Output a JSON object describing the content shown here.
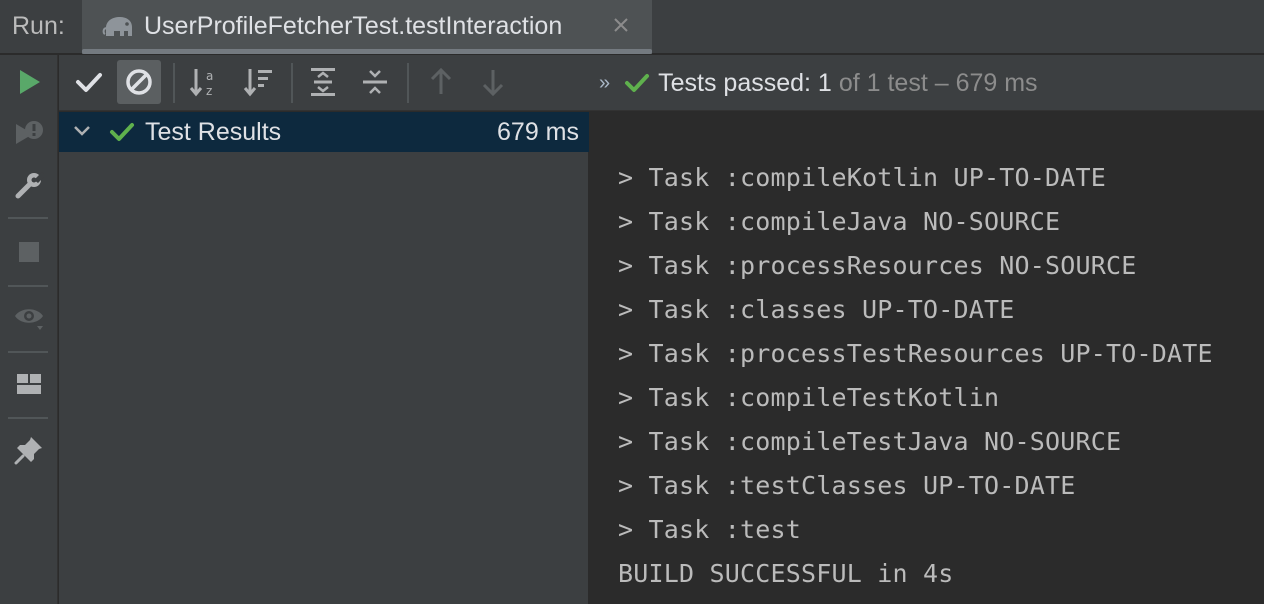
{
  "topbar": {
    "run_label": "Run:",
    "tab_title": "UserProfileFetcherTest.testInteraction",
    "tab_icon": "gradle-elephant-icon"
  },
  "left_toolbar": {
    "items": [
      "rerun-icon",
      "rerun-failed-icon",
      "settings-wrench-icon",
      "stop-icon",
      "show-preview-eye-icon",
      "layout-icon",
      "pin-icon"
    ]
  },
  "toolbar": {
    "items": [
      "show-passed-icon",
      "show-ignored-icon",
      "sort-alphabetically-icon",
      "sort-by-duration-icon",
      "expand-all-icon",
      "collapse-all-icon",
      "previous-failed-icon",
      "next-failed-icon"
    ],
    "more": "»"
  },
  "status": {
    "passed_text": "Tests passed: 1",
    "rest_text": "of 1 test – 679 ms",
    "color_success": "#5fb14d"
  },
  "tree": {
    "root_label": "Test Results",
    "root_time": "679 ms"
  },
  "console": {
    "lines": [
      "> Task :compileKotlin UP-TO-DATE",
      "> Task :compileJava NO-SOURCE",
      "> Task :processResources NO-SOURCE",
      "> Task :classes UP-TO-DATE",
      "> Task :processTestResources UP-TO-DATE",
      "> Task :compileTestKotlin",
      "> Task :compileTestJava NO-SOURCE",
      "> Task :testClasses UP-TO-DATE",
      "> Task :test",
      "BUILD SUCCESSFUL in 4s"
    ]
  }
}
